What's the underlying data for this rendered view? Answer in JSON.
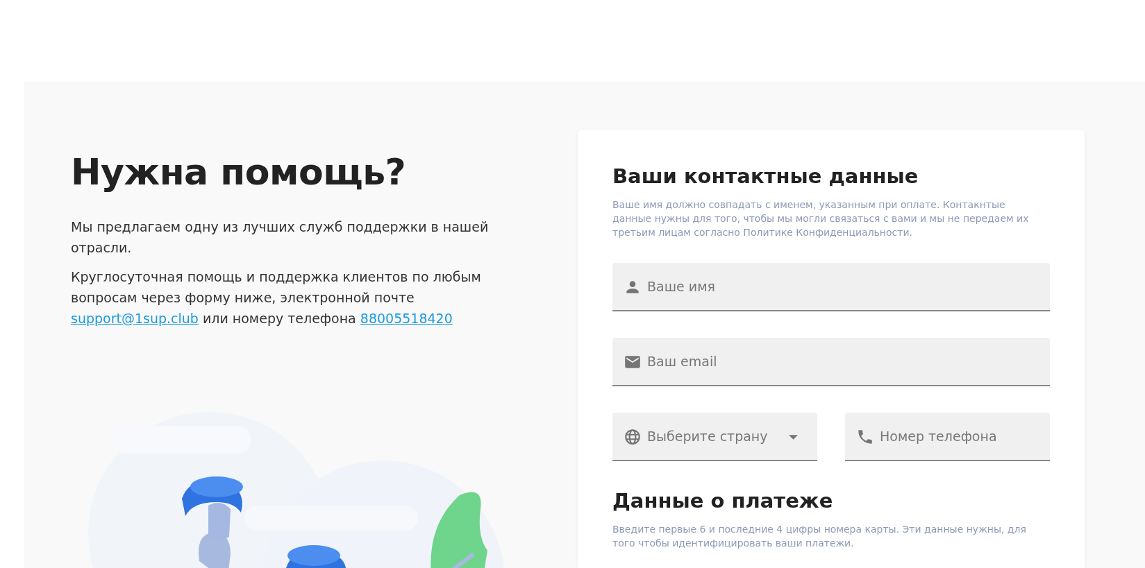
{
  "help": {
    "title": "Нужна помощь?",
    "paragraphs": [
      {
        "segments": [
          {
            "kind": "text",
            "text": "Мы предлагаем одну из лучших служб поддержки в нашей отрасли."
          }
        ]
      },
      {
        "segments": [
          {
            "kind": "text",
            "text": "Круглосуточная помощь и поддержка клиентов по любым вопросам через форму ниже, электронной почте "
          },
          {
            "kind": "link",
            "text": "support@1sup.club"
          },
          {
            "kind": "text",
            "text": " или номеру телефона "
          },
          {
            "kind": "link",
            "text": "88005518420"
          }
        ]
      }
    ]
  },
  "contact_form": {
    "title": "Ваши контактные данные",
    "note": "Ваше имя должно совпадать с именем, указанным при оплате. Контакнтые данные нужны для того, чтобы мы могли связаться с вами и мы не передаем их третьим лицам согласно Политике Конфиденциальности.",
    "rows": [
      {
        "fields": [
          {
            "kind": "name",
            "placeholder": "Ваше имя"
          }
        ]
      },
      {
        "fields": [
          {
            "kind": "email",
            "placeholder": "Ваш email"
          }
        ]
      },
      {
        "fields": [
          {
            "kind": "country",
            "placeholder": "Выберите страну"
          },
          {
            "kind": "phone",
            "placeholder": "Номер телефона"
          }
        ]
      }
    ]
  },
  "payment": {
    "title": "Данные о платеже",
    "note": "Введите первые 6 и последние 4 цифры номера карты. Эти данные нужны, для того чтобы идентифицировать ваши платежи."
  }
}
